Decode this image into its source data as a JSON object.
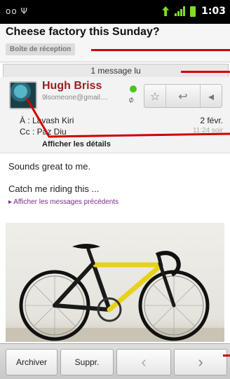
{
  "status_bar": {
    "left_icons": "oo Ψ",
    "time": "1:03"
  },
  "conversation": {
    "subject": "Cheese factory this Sunday?",
    "label": "Boîte de réception",
    "read_count": "1 message lu"
  },
  "message": {
    "sender_name": "Hugh Briss",
    "sender_email": "9lsomeone@gmail....",
    "to": "À : Lavash Kiri",
    "cc": "Cc : Paz Diu",
    "date": "2 févr.",
    "time": "11:24 soir",
    "details_link": "Afficher les détails",
    "body_line1": "Sounds great to me.",
    "body_line2": "Catch me riding this ...",
    "show_previous": "▸ Afficher les messages précédents"
  },
  "bottom_bar": {
    "archive": "Archiver",
    "delete": "Suppr."
  },
  "colors": {
    "sender": "#9c1f1f",
    "presence": "#45c81a",
    "callout": "#d10000"
  }
}
